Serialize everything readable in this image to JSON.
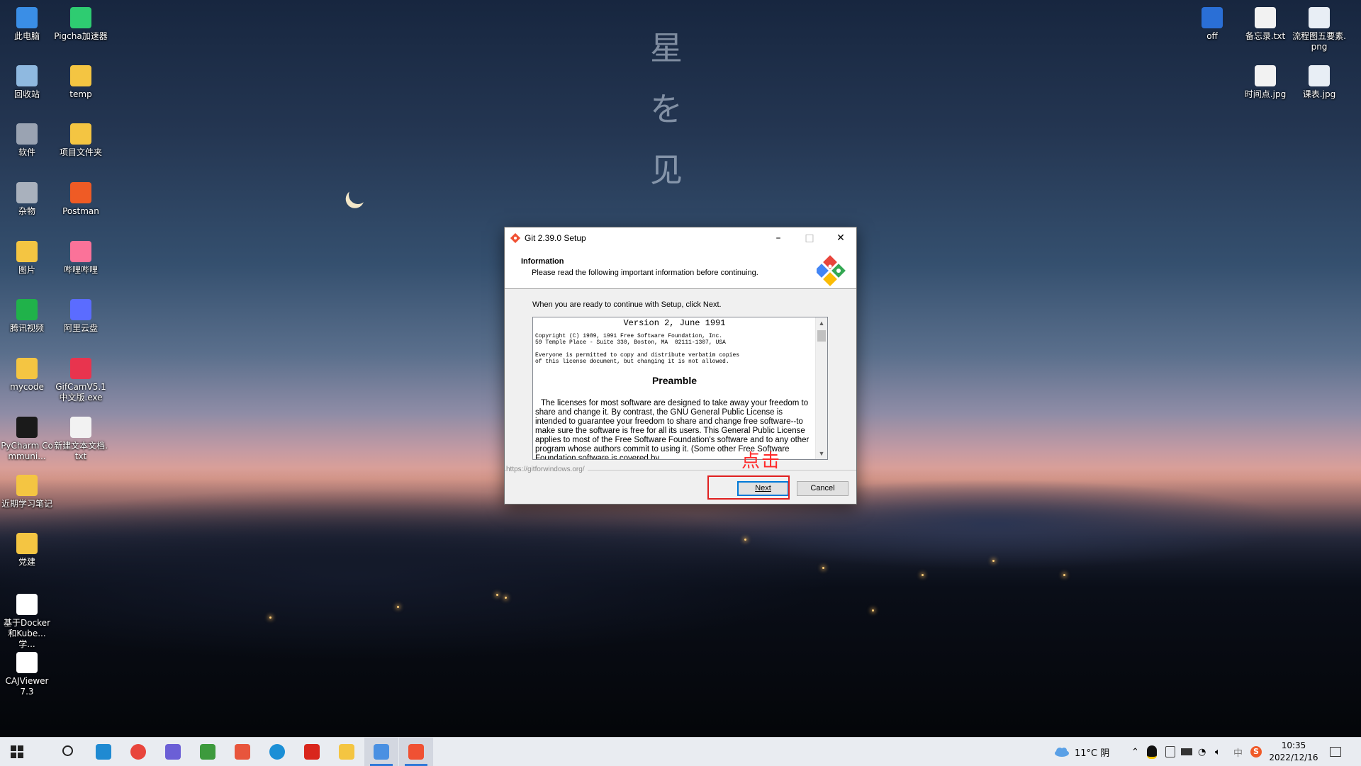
{
  "wallpaper": {
    "vertical_text": [
      "星",
      "を",
      "见"
    ]
  },
  "desktop_left": [
    {
      "label": "此电脑",
      "icon": "computer-icon",
      "color": "#3a8ee6"
    },
    {
      "label": "Pigcha加速器",
      "icon": "pigcha-icon",
      "color": "#2ecc71"
    },
    {
      "label": "回收站",
      "icon": "recycle-bin-icon",
      "color": "#8fb9e0"
    },
    {
      "label": "temp",
      "icon": "folder-icon",
      "color": "#f4c542"
    },
    {
      "label": "软件",
      "icon": "dvd-drive-icon",
      "color": "#9aa3b2"
    },
    {
      "label": "项目文件夹",
      "icon": "folder-icon",
      "color": "#f4c542"
    },
    {
      "label": "杂物",
      "icon": "disk-drive-icon",
      "color": "#a9b1bd"
    },
    {
      "label": "Postman",
      "icon": "postman-icon",
      "color": "#ef5b25"
    },
    {
      "label": "图片",
      "icon": "folder-icon",
      "color": "#f4c542"
    },
    {
      "label": "哔哩哔哩",
      "icon": "bilibili-icon",
      "color": "#fb7299"
    },
    {
      "label": "腾讯视频",
      "icon": "tencent-video-icon",
      "color": "#20b24a"
    },
    {
      "label": "阿里云盘",
      "icon": "aliyun-drive-icon",
      "color": "#5b6cff"
    },
    {
      "label": "mycode",
      "icon": "folder-icon",
      "color": "#f4c542"
    },
    {
      "label": "GifCamV5.1中文版.exe",
      "icon": "gifcam-icon",
      "color": "#e8344e"
    },
    {
      "label": "PyCharm Communi...",
      "icon": "pycharm-icon",
      "color": "#1a1a1a"
    },
    {
      "label": "新建文本文档.txt",
      "icon": "text-file-icon",
      "color": "#f2f2f2"
    },
    {
      "label": "近期学习笔记",
      "icon": "folder-icon",
      "color": "#f4c542"
    },
    {
      "label": "党建",
      "icon": "folder-icon",
      "color": "#f4c542"
    },
    {
      "label": "基于Docker和Kube...学...",
      "icon": "document-icon",
      "color": "#ffffff"
    },
    {
      "label": "CAJViewer 7.3",
      "icon": "document-icon",
      "color": "#ffffff"
    }
  ],
  "desktop_right": [
    {
      "label": "off",
      "icon": "power-icon",
      "color": "#2a6fd6"
    },
    {
      "label": "备忘录.txt",
      "icon": "text-file-icon",
      "color": "#f2f2f2"
    },
    {
      "label": "流程图五要素.png",
      "icon": "image-file-icon",
      "color": "#e8eef5"
    },
    {
      "label": "时间点.jpg",
      "icon": "image-file-icon",
      "color": "#f2f2f2"
    },
    {
      "label": "课表.jpg",
      "icon": "image-file-icon",
      "color": "#e8eef5"
    }
  ],
  "dialog": {
    "title": "Git 2.39.0 Setup",
    "minimize": "–",
    "maximize": "□",
    "close": "✕",
    "header_title": "Information",
    "header_subtitle": "Please read the following important information before continuing.",
    "intro": "When you are ready to continue with Setup, click Next.",
    "license": {
      "version": "Version 2, June 1991",
      "copyright": "Copyright (C) 1989, 1991 Free Software Foundation, Inc.\n59 Temple Place - Suite 330, Boston, MA  02111-1307, USA",
      "everyone": "Everyone is permitted to copy and distribute verbatim copies\nof this license document, but changing it is not allowed.",
      "preamble": "Preamble",
      "paragraph": "The licenses for most software are designed to take away your freedom to share and change it. By contrast, the GNU General Public License is intended to guarantee your freedom to share and change free software--to make sure the software is free for all its users. This General Public License applies to most of the Free Software Foundation's software and to any other program whose authors commit to using it. (Some other Free Software Foundation software is covered by"
    },
    "url": "https://gitforwindows.org/",
    "next_label": "Next",
    "cancel_label": "Cancel"
  },
  "annotation": {
    "text": "点击",
    "color": "#e02020"
  },
  "taskbar": {
    "apps": [
      {
        "name": "start-icon",
        "active": false
      },
      {
        "name": "search-icon",
        "active": false
      },
      {
        "name": "vscode-icon",
        "active": false,
        "color": "#1f8ad2"
      },
      {
        "name": "chrome-icon",
        "active": false,
        "color": "#e8453c"
      },
      {
        "name": "feather-app-icon",
        "active": false,
        "color": "#6b5fd6"
      },
      {
        "name": "store-icon",
        "active": false,
        "color": "#3d9a3d"
      },
      {
        "name": "browser-icon",
        "active": false,
        "color": "#e8553c"
      },
      {
        "name": "edge-icon",
        "active": false,
        "color": "#1b8fd6"
      },
      {
        "name": "wps-icon",
        "active": false,
        "color": "#d9261c"
      },
      {
        "name": "file-explorer-icon",
        "active": false,
        "color": "#f4c542"
      },
      {
        "name": "network-app-icon",
        "active": true,
        "color": "#4a90e2"
      },
      {
        "name": "git-setup-icon",
        "active": true,
        "color": "#f05133"
      }
    ],
    "weather": "11°C 阴",
    "time": "10:35",
    "date": "2022/12/16"
  }
}
